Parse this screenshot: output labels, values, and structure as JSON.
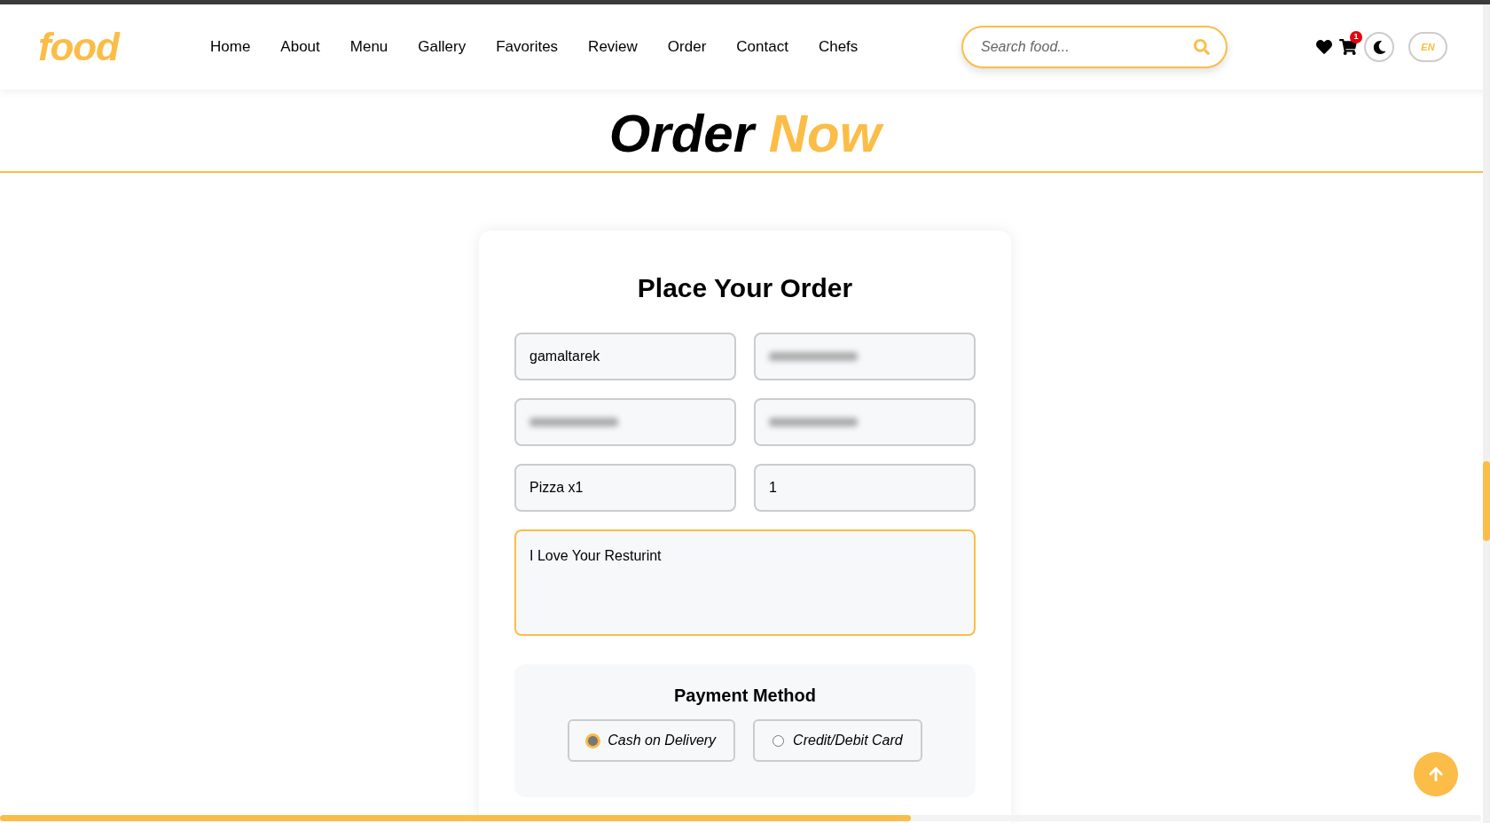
{
  "header": {
    "logo": "food",
    "nav": [
      {
        "label": "Home"
      },
      {
        "label": "About"
      },
      {
        "label": "Menu"
      },
      {
        "label": "Gallery"
      },
      {
        "label": "Favorites"
      },
      {
        "label": "Review"
      },
      {
        "label": "Order"
      },
      {
        "label": "Contact"
      },
      {
        "label": "Chefs"
      }
    ],
    "search": {
      "placeholder": "Search food..."
    },
    "cart_count": "1",
    "language": "EN"
  },
  "page_title": {
    "text": "Order",
    "highlight": "Now"
  },
  "form": {
    "title": "Place Your Order",
    "fields": [
      {
        "value": "gamaltarek",
        "blurred": false
      },
      {
        "blurred": true
      },
      {
        "blurred": true
      },
      {
        "blurred": true
      },
      {
        "value": "Pizza x1",
        "blurred": false
      },
      {
        "value": "1",
        "blurred": false
      }
    ],
    "message": {
      "value": "I Love Your Resturint",
      "focused": true
    },
    "payment": {
      "title": "Payment Method",
      "options": [
        {
          "label": "Cash on Delivery",
          "selected": true
        },
        {
          "label": "Credit/Debit Card",
          "selected": false
        }
      ]
    }
  },
  "scroll_progress": {
    "level": 0.615
  }
}
